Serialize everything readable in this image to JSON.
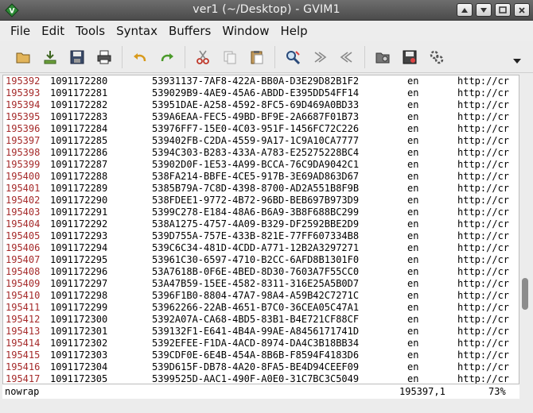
{
  "window": {
    "title": "ver1 (~/Desktop) - GVIM1",
    "icons": [
      "vim-icon",
      "arrow-up-icon",
      "arrow-down-icon",
      "maximize-icon",
      "close-icon"
    ]
  },
  "menu": [
    "File",
    "Edit",
    "Tools",
    "Syntax",
    "Buffers",
    "Window",
    "Help"
  ],
  "toolbar": [
    "open-icon",
    "save-download-icon",
    "save-icon",
    "print-icon",
    "undo-icon",
    "redo-icon",
    "cut-icon",
    "copy-icon",
    "paste-icon",
    "find-replace-icon",
    "find-next-icon",
    "find-prev-icon",
    "load-session-icon",
    "save-session-icon",
    "make-icon",
    "overflow-chevron-icon"
  ],
  "lines": [
    {
      "n": "195392",
      "a": "1091172280",
      "b": "53931137-7AF8-422A-BB0A-D3E29D82B1F2",
      "c": "en",
      "d": "http://cr"
    },
    {
      "n": "195393",
      "a": "1091172281",
      "b": "539029B9-4AE9-45A6-ABDD-E395DD54FF14",
      "c": "en",
      "d": "http://cr"
    },
    {
      "n": "195394",
      "a": "1091172282",
      "b": "53951DAE-A258-4592-8FC5-69D469A0BD33",
      "c": "en",
      "d": "http://cr"
    },
    {
      "n": "195395",
      "a": "1091172283",
      "b": "539A6EAA-FEC5-49BD-BF9E-2A6687F01B73",
      "c": "en",
      "d": "http://cr"
    },
    {
      "n": "195396",
      "a": "1091172284",
      "b": "53976FF7-15E0-4C03-951F-1456FC72C226",
      "c": "en",
      "d": "http://cr"
    },
    {
      "n": "195397",
      "a": "1091172285",
      "b": "539402FB-C2DA-4559-9A17-1C9A10CA7777",
      "c": "en",
      "d": "http://cr"
    },
    {
      "n": "195398",
      "a": "1091172286",
      "b": "5394C303-B283-433A-A783-E25275228BC4",
      "c": "en",
      "d": "http://cr"
    },
    {
      "n": "195399",
      "a": "1091172287",
      "b": "53902D0F-1E53-4A99-BCCA-76C9DA9042C1",
      "c": "en",
      "d": "http://cr"
    },
    {
      "n": "195400",
      "a": "1091172288",
      "b": "538FA214-BBFE-4CE5-917B-3E69AD863D67",
      "c": "en",
      "d": "http://cr"
    },
    {
      "n": "195401",
      "a": "1091172289",
      "b": "5385B79A-7C8D-4398-8700-AD2A551B8F9B",
      "c": "en",
      "d": "http://cr"
    },
    {
      "n": "195402",
      "a": "1091172290",
      "b": "538FDEE1-9772-4B72-96BD-BEB697B973D9",
      "c": "en",
      "d": "http://cr"
    },
    {
      "n": "195403",
      "a": "1091172291",
      "b": "5399C278-E184-48A6-B6A9-3B8F688BC299",
      "c": "en",
      "d": "http://cr"
    },
    {
      "n": "195404",
      "a": "1091172292",
      "b": "538A1275-4757-4A09-B329-DF2592BBE2D9",
      "c": "en",
      "d": "http://cr"
    },
    {
      "n": "195405",
      "a": "1091172293",
      "b": "539D755A-757E-433B-821E-77FF607334B8",
      "c": "en",
      "d": "http://cr"
    },
    {
      "n": "195406",
      "a": "1091172294",
      "b": "539C6C34-481D-4CDD-A771-12B2A3297271",
      "c": "en",
      "d": "http://cr"
    },
    {
      "n": "195407",
      "a": "1091172295",
      "b": "53961C30-6597-4710-B2CC-6AFD8B1301F0",
      "c": "en",
      "d": "http://cr"
    },
    {
      "n": "195408",
      "a": "1091172296",
      "b": "53A7618B-0F6E-4BED-8D30-7603A7F55CC0",
      "c": "en",
      "d": "http://cr"
    },
    {
      "n": "195409",
      "a": "1091172297",
      "b": "53A47B59-15EE-4582-8311-316E25A5B0D7",
      "c": "en",
      "d": "http://cr"
    },
    {
      "n": "195410",
      "a": "1091172298",
      "b": "5396F1B0-8804-47A7-98A4-A59B42C7271C",
      "c": "en",
      "d": "http://cr"
    },
    {
      "n": "195411",
      "a": "1091172299",
      "b": "53962266-22AB-4651-B7C0-36CEA05C47A1",
      "c": "en",
      "d": "http://cr"
    },
    {
      "n": "195412",
      "a": "1091172300",
      "b": "5392A07A-CA68-4BD5-83B1-B4E721CF88CF",
      "c": "en",
      "d": "http://cr"
    },
    {
      "n": "195413",
      "a": "1091172301",
      "b": "539132F1-E641-4B4A-99AE-A8456171741D",
      "c": "en",
      "d": "http://cr"
    },
    {
      "n": "195414",
      "a": "1091172302",
      "b": "5392EFEE-F1DA-4ACD-8974-DA4C3B18BB34",
      "c": "en",
      "d": "http://cr"
    },
    {
      "n": "195415",
      "a": "1091172303",
      "b": "539CDF0E-6E4B-454A-8B6B-F8594F4183D6",
      "c": "en",
      "d": "http://cr"
    },
    {
      "n": "195416",
      "a": "1091172304",
      "b": "539D615F-DB78-4A20-8FA5-BE4D94CEEF09",
      "c": "en",
      "d": "http://cr"
    },
    {
      "n": "195417",
      "a": "1091172305",
      "b": "5399525D-AAC1-490F-A0E0-31C7BC3C5049",
      "c": "en",
      "d": "http://cr"
    }
  ],
  "status": {
    "mode": "nowrap",
    "position": "195397,1",
    "percent": "73%"
  },
  "colors": {
    "line_number": "#a52a2a",
    "text": "#000000",
    "background": "#ffffff"
  }
}
